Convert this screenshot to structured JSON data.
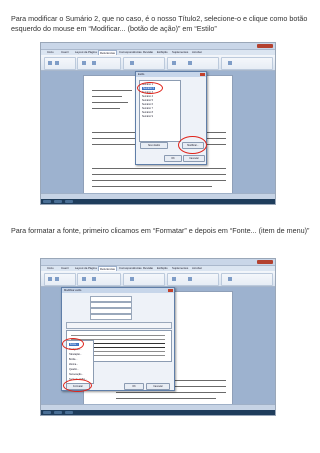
{
  "instructions": {
    "p1": "Para modificar o Sumário 2, que no caso, é o nosso Título2, selecione-o e clique como botão esquerdo do mouse em “Modificar... (botão de ação)” em “Estilo”",
    "p2": "Para formatar a fonte, primeiro clicamos em “Formatar” e depois  em “Fonte... (item de menu)”"
  },
  "screenshot1": {
    "ribbon_tabs": [
      "Início",
      "Inserir",
      "Layout da Página",
      "Referências",
      "Correspondências",
      "Revisão",
      "Exibição",
      "Suplementos",
      "Acrobat"
    ],
    "dialog_title": "Estilo",
    "list_items": [
      "Sumário 1",
      "Sumário 2",
      "Sumário 3",
      "Sumário 4",
      "Sumário 5",
      "Sumário 6",
      "Sumário 7",
      "Sumário 8",
      "Sumário 9"
    ],
    "selected_item": "Sumário 2",
    "buttons": {
      "new": "Novo Estilo",
      "modify": "Modificar...",
      "ok": "OK",
      "cancel": "Cancelar"
    }
  },
  "screenshot2": {
    "ribbon_tabs": [
      "Início",
      "Inserir",
      "Layout da Página",
      "Referências",
      "Correspondências",
      "Revisão",
      "Exibição",
      "Suplementos",
      "Acrobat"
    ],
    "dialog_title": "Modificar estilo",
    "format_menu": [
      "Fonte...",
      "Parágrafo...",
      "Tabulação...",
      "Borda...",
      "Idioma...",
      "Quadro...",
      "Numeração...",
      "Tecla de atalho..."
    ],
    "highlighted_menu_item": "Fonte...",
    "buttons": {
      "format": "Formatar",
      "ok": "OK",
      "cancel": "Cancelar"
    }
  },
  "colors": {
    "highlight_ring": "#e0241b",
    "selection": "#3d74c4"
  }
}
